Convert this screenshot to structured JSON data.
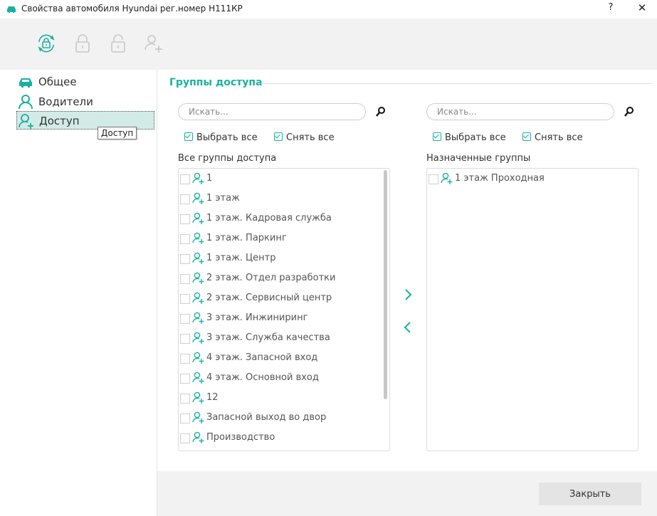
{
  "window": {
    "title": "Свойства автомобиля Hyundai  рег.номер Н111КР",
    "help_label": "?",
    "close_label": "✕"
  },
  "toolbar": {
    "icons": [
      "sync-lock-icon",
      "lock-icon",
      "unlock-icon",
      "add-user-icon"
    ]
  },
  "sidebar": {
    "items": [
      {
        "label": "Общее",
        "icon": "car-icon"
      },
      {
        "label": "Водители",
        "icon": "person-icon"
      },
      {
        "label": "Доступ",
        "icon": "access-group-icon",
        "active": true
      }
    ],
    "tooltip": "Доступ"
  },
  "access": {
    "section_title": "Группы доступа",
    "left": {
      "search_placeholder": "Искать...",
      "select_all": "Выбрать все",
      "clear_all": "Снять все",
      "list_label": "Все группы доступа",
      "items": [
        "1",
        "1 этаж",
        "1 этаж. Кадровая служба",
        "1 этаж. Паркинг",
        "1 этаж. Центр",
        "2 этаж. Отдел разработки",
        "2 этаж. Сервисный центр",
        "3 этаж. Инжиниринг",
        "3 этаж. Служба качества",
        "4 этаж. Запасной вход",
        "4 этаж. Основной вход",
        "12",
        "Запасной выход во двор",
        "Производство"
      ]
    },
    "right": {
      "search_placeholder": "Искать...",
      "select_all": "Выбрать все",
      "clear_all": "Снять все",
      "list_label": "Назначенные группы",
      "items": [
        "1 этаж Проходная"
      ]
    }
  },
  "footer": {
    "close_label": "Закрыть"
  },
  "colors": {
    "accent": "#1ab0a0",
    "active_bg": "#d3ebe7",
    "toolbar_bg": "#f2f2f2",
    "disabled_icon": "#c8c8c8"
  }
}
